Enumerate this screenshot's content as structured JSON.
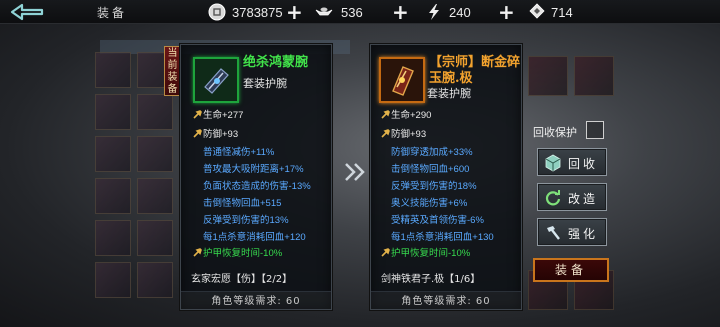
{
  "header": {
    "title": "装备",
    "resources": [
      {
        "icon": "silver-coin-icon",
        "value": "3783875"
      },
      {
        "icon": "ingot-icon",
        "value": "536"
      },
      {
        "icon": "lightning-icon",
        "value": "240"
      },
      {
        "icon": "ticket-icon",
        "value": "714"
      }
    ],
    "plus": "+"
  },
  "current_tag": "当前装备",
  "current_item": {
    "name": "绝杀鸿蒙腕",
    "type": "套装护腕",
    "base_attrs": [
      "生命+277",
      "防御+93"
    ],
    "extra_attrs": [
      "普通怪减伤+11%",
      "普攻最大吸附距离+17%",
      "负面状态造成的伤害-13%",
      "击倒怪物回血+515",
      "反弹受到伤害的13%",
      "每1点杀意消耗回血+120",
      "护甲恢复时间-10%"
    ],
    "set_line": "玄家宏愿【伤】【2/2】",
    "requirement": "角色等级需求: 60"
  },
  "compare_item": {
    "name": "【宗师】断金碎玉腕.极",
    "type": "套装护腕",
    "base_attrs": [
      "生命+290",
      "防御+93"
    ],
    "extra_attrs": [
      "防御穿透加成+33%",
      "击倒怪物回血+600",
      "反弹受到伤害的18%",
      "奥义技能伤害+6%",
      "受精英及首领伤害-6%",
      "每1点杀意消耗回血+130",
      "护甲恢复时间-10%"
    ],
    "set_line": "剑神铁君子.极【1/6】",
    "requirement": "角色等级需求: 60"
  },
  "actions": {
    "recycle_protect": "回收保护",
    "recycle": "回收",
    "reforge": "改造",
    "strengthen": "强化",
    "equip": "装备"
  },
  "colors": {
    "green_name": "#41e24a",
    "orange_name": "#f2a22e",
    "blue_attr": "#5aa9ff"
  }
}
